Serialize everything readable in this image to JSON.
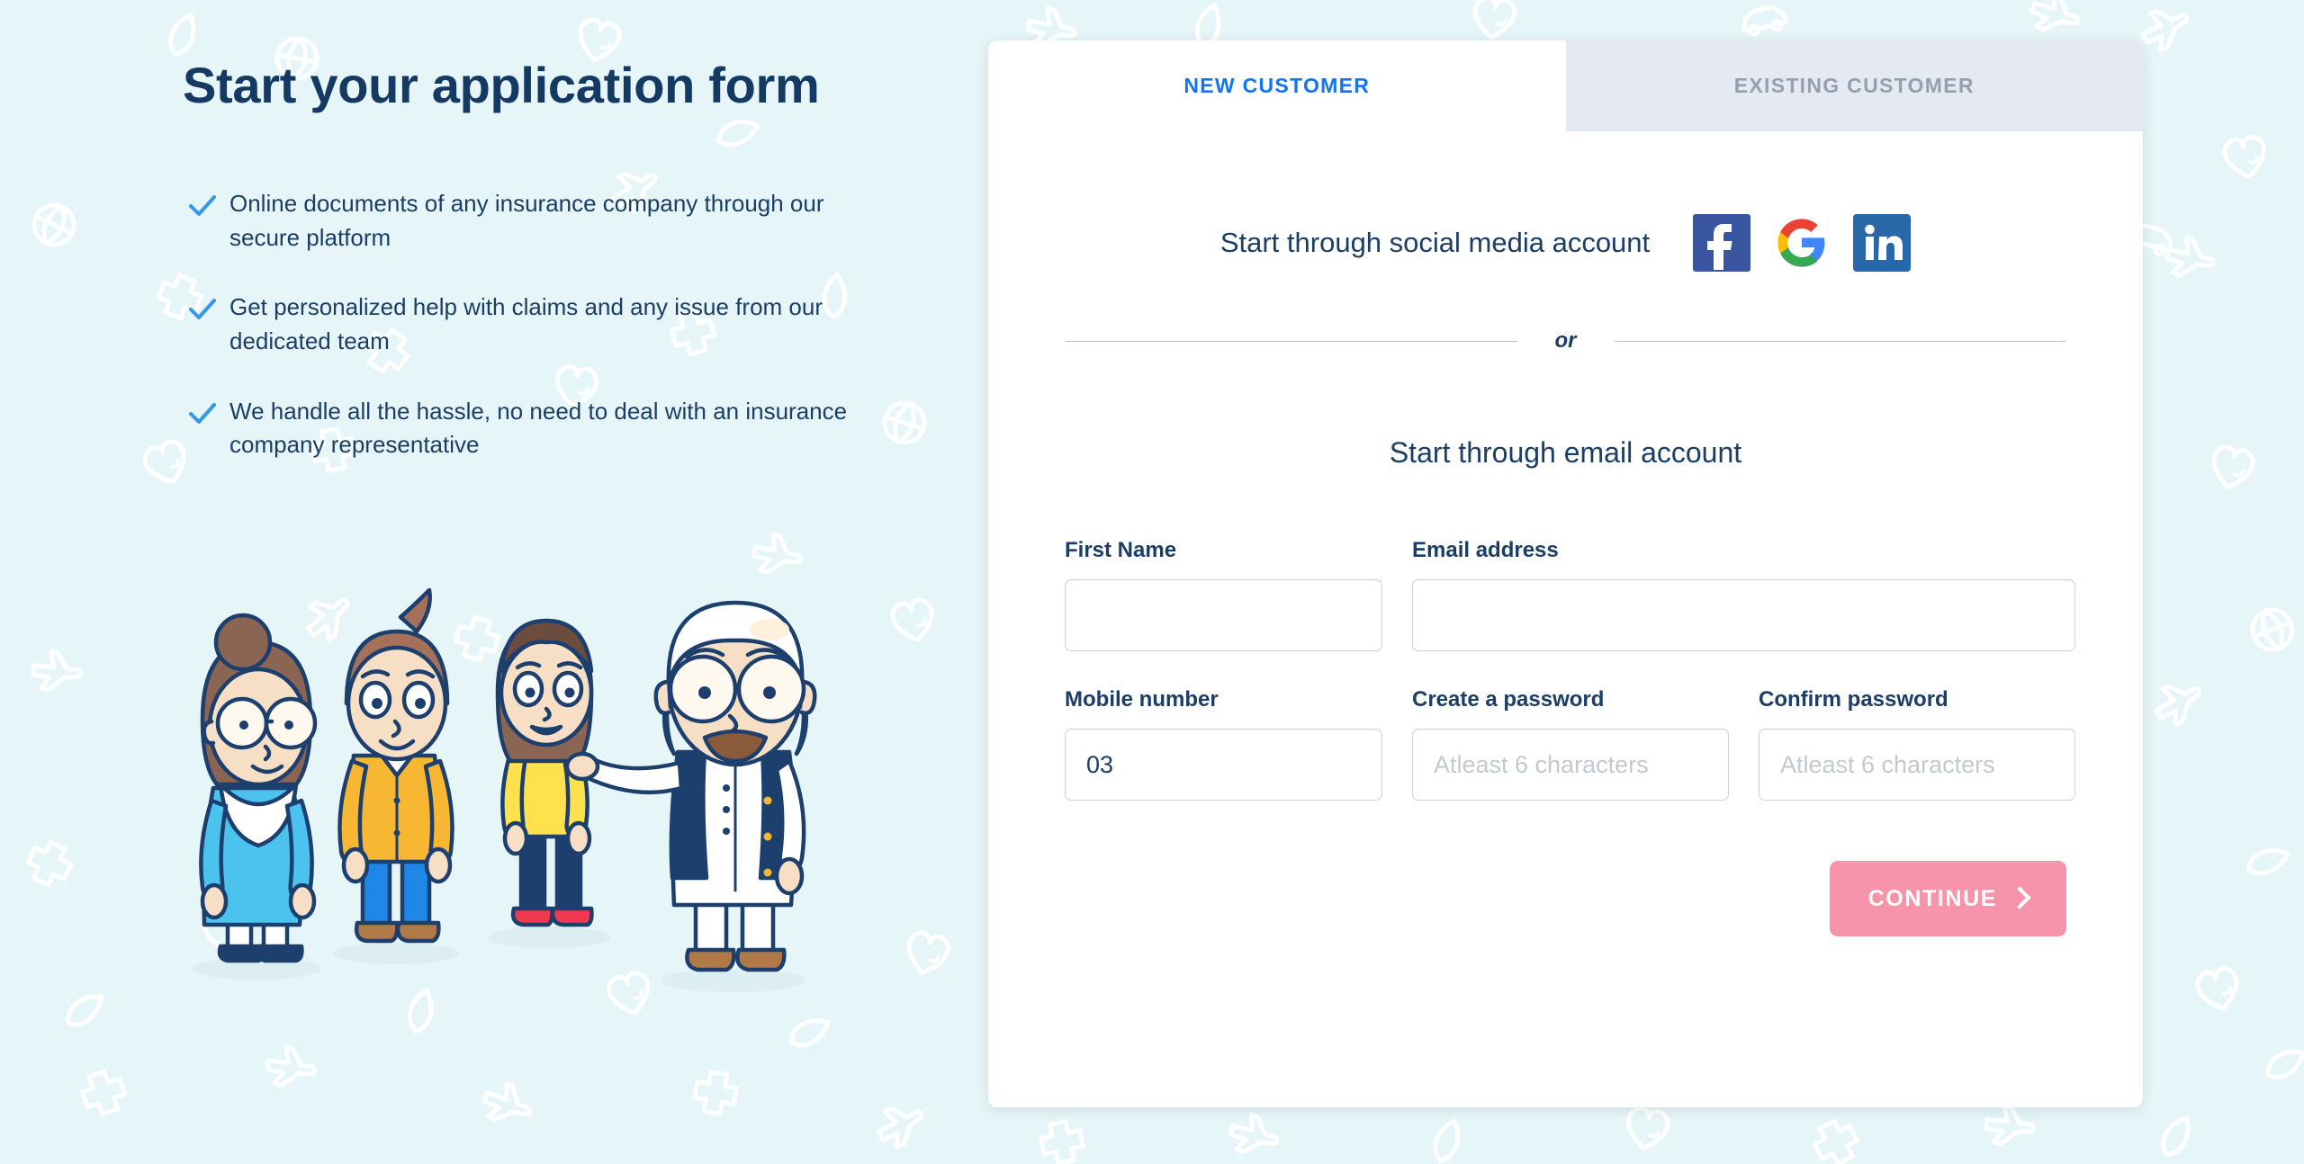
{
  "theme": {
    "page_background": "#e6f5f7",
    "heading_color": "#143a63",
    "accent_blue": "#1274f0",
    "check_color": "#3498e8",
    "continue_button_color": "#f794ab",
    "inactive_tab_color": "#e5e9f1",
    "card_background": "#ffffff"
  },
  "left": {
    "title": "Start your application form",
    "benefits": [
      {
        "icon": "check-icon",
        "text": "Online documents of any insurance company through our secure platform"
      },
      {
        "icon": "check-icon",
        "text": "Get personalized help with claims and any issue from our dedicated team"
      },
      {
        "icon": "check-icon",
        "text": "We handle all the hassle, no need to deal with an insurance company representative"
      }
    ],
    "illustration": "family-illustration"
  },
  "card": {
    "tabs": [
      {
        "label": "NEW CUSTOMER",
        "active": true
      },
      {
        "label": "EXISTING CUSTOMER",
        "active": false
      }
    ],
    "social": {
      "label": "Start through social media account",
      "buttons": [
        {
          "name": "facebook-icon",
          "label": "Facebook",
          "color": "#3a559f"
        },
        {
          "name": "google-icon",
          "label": "Google",
          "color": "#4285f4"
        },
        {
          "name": "linkedin-icon",
          "label": "LinkedIn",
          "color": "#2867a8"
        }
      ]
    },
    "divider_word": "or",
    "email_heading": "Start through email account",
    "form": {
      "rows": [
        {
          "fields": [
            {
              "name": "first-name",
              "label": "First Name",
              "value": "",
              "placeholder": ""
            },
            {
              "name": "email-address",
              "label": "Email address",
              "value": "",
              "placeholder": ""
            }
          ]
        },
        {
          "fields": [
            {
              "name": "mobile-number",
              "label": "Mobile number",
              "value": "03",
              "placeholder": ""
            },
            {
              "name": "create-password",
              "label": "Create a password",
              "value": "",
              "placeholder": "Atleast 6 characters"
            },
            {
              "name": "confirm-password",
              "label": "Confirm password",
              "value": "",
              "placeholder": "Atleast 6 characters"
            }
          ]
        }
      ],
      "submit_label": "CONTINUE"
    }
  }
}
